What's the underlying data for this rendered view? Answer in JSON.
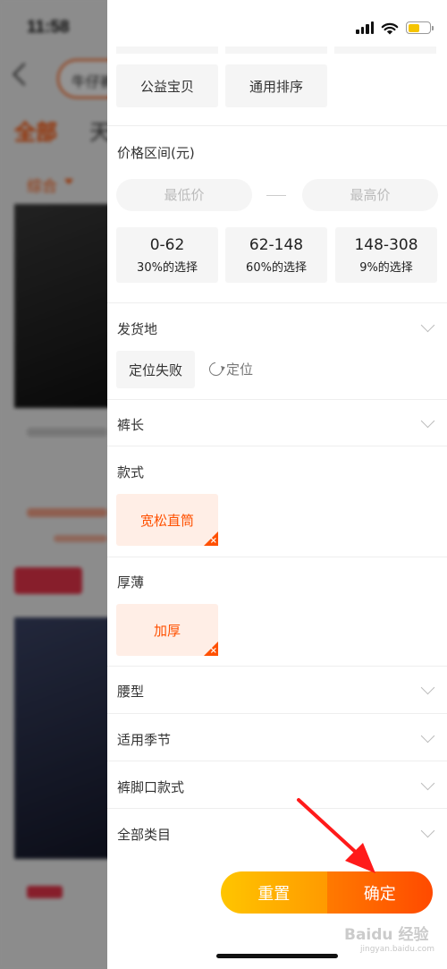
{
  "background": {
    "status_time": "11:58",
    "search_value": "牛仔裤",
    "tabs": [
      "全部",
      "天"
    ],
    "sort_label": "综合"
  },
  "panel": {
    "service_chips": [
      "公益宝贝",
      "通用排序"
    ],
    "price": {
      "title": "价格区间(元)",
      "min_placeholder": "最低价",
      "max_placeholder": "最高价",
      "ranges": [
        {
          "range": "0-62",
          "pct": "30%的选择"
        },
        {
          "range": "62-148",
          "pct": "60%的选择"
        },
        {
          "range": "148-308",
          "pct": "9%的选择"
        }
      ]
    },
    "ship_from": {
      "title": "发货地",
      "chip": "定位失败",
      "locate_label": "定位"
    },
    "pant_length": {
      "title": "裤长"
    },
    "style": {
      "title": "款式",
      "selected": "宽松直筒"
    },
    "thickness": {
      "title": "厚薄",
      "selected": "加厚"
    },
    "waist": {
      "title": "腰型"
    },
    "season": {
      "title": "适用季节"
    },
    "hem": {
      "title": "裤脚口款式"
    },
    "category": {
      "title": "全部类目"
    },
    "buttons": {
      "reset": "重置",
      "confirm": "确定"
    }
  },
  "watermark": {
    "text": "Baidu 经验",
    "sub": "jingyan.baidu.com"
  },
  "colors": {
    "accent": "#ff5000",
    "selected_bg": "#ffeee6",
    "chip_bg": "#f5f5f5",
    "reset_gradient": [
      "#ffc500",
      "#ff9a00"
    ],
    "confirm_gradient": [
      "#ff7a00",
      "#ff4a00"
    ],
    "battery": "#f5c400",
    "arrow": "#ff1a1a"
  },
  "icons": {
    "back": "chevron-left-icon",
    "expand": "chevron-down-icon",
    "locate": "refresh-icon",
    "deselect": "close-icon"
  }
}
